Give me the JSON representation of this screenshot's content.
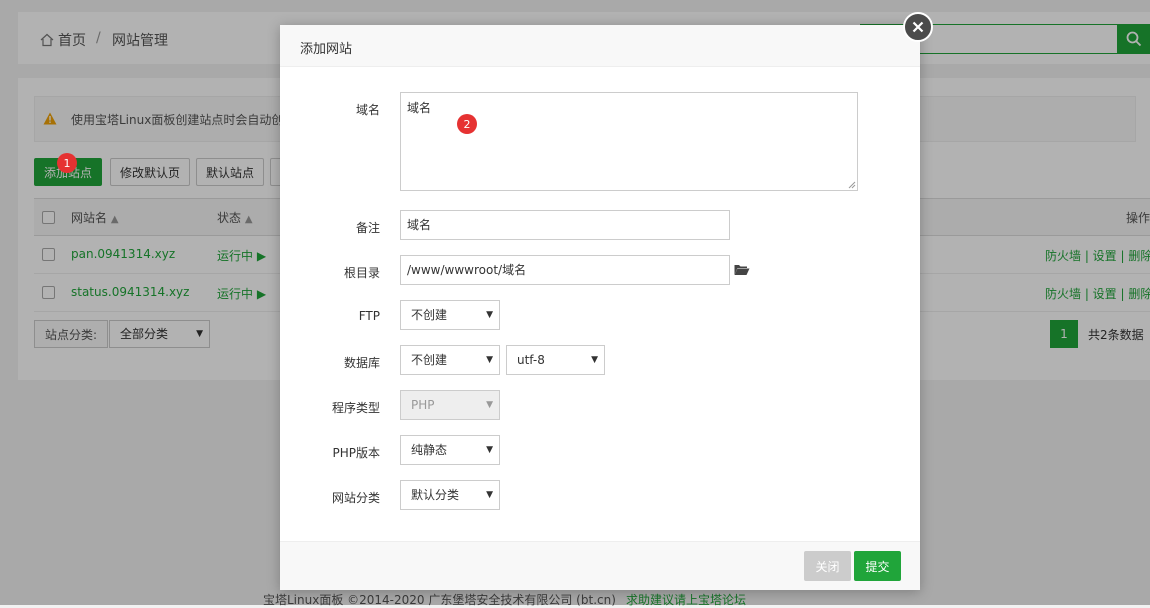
{
  "breadcrumb": {
    "home": "首页",
    "sep": "/",
    "current": "网站管理"
  },
  "notice": {
    "text": "使用宝塔Linux面板创建站点时会自动创"
  },
  "toolbar": {
    "add_site": "添加站点",
    "edit_default_page": "修改默认页",
    "default_site": "默认站点"
  },
  "table": {
    "headers": {
      "name": "网站名",
      "status": "状态",
      "actions": "操作"
    },
    "rows": [
      {
        "name": "pan.0941314.xyz",
        "status": "运行中 ▶",
        "actions": "防火墙 | 设置 | 删除"
      },
      {
        "name": "status.0941314.xyz",
        "status": "运行中 ▶",
        "actions": "防火墙 | 设置 | 删除"
      }
    ]
  },
  "category_filter": {
    "label": "站点分类:",
    "value": "全部分类"
  },
  "pagination": {
    "page": "1",
    "total": "共2条数据"
  },
  "footer": {
    "copyright": "宝塔Linux面板 ©2014-2020 广东堡塔安全技术有限公司 (bt.cn)",
    "link": "求助建议请上宝塔论坛"
  },
  "modal": {
    "title": "添加网站",
    "domain": {
      "label": "域名",
      "value": "域名"
    },
    "remark": {
      "label": "备注",
      "value": "域名"
    },
    "root_dir": {
      "label": "根目录",
      "value": "/www/wwwroot/域名"
    },
    "ftp": {
      "label": "FTP",
      "value": "不创建"
    },
    "database": {
      "label": "数据库",
      "value": "不创建",
      "charset": "utf-8"
    },
    "program_type": {
      "label": "程序类型",
      "value": "PHP"
    },
    "php_version": {
      "label": "PHP版本",
      "value": "纯静态"
    },
    "site_category": {
      "label": "网站分类",
      "value": "默认分类"
    },
    "buttons": {
      "close": "关闭",
      "submit": "提交"
    }
  },
  "annotations": {
    "badge1": "1",
    "badge2": "2"
  },
  "colors": {
    "accent": "#20a53a",
    "badge": "#e63232",
    "disabled": "#cccccc"
  },
  "icons": [
    "home-icon",
    "search-icon",
    "warning-icon",
    "sort-up-icon",
    "folder-open-icon",
    "close-icon",
    "chevron-down-icon"
  ]
}
